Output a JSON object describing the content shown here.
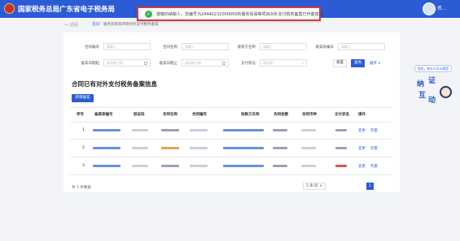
{
  "header": {
    "brand": "国家税务总局广东省电子税务局",
    "user": "郑..."
  },
  "toast": {
    "message": "尊敬的纳税人，您编号为24440232000000的服务贸易等项目对外支付税务备案已作废成功。"
  },
  "breadcrumb": {
    "back": "← 返回",
    "home": "首页",
    "sep": "/",
    "current": "服务贸易等项目对外支付税务备案"
  },
  "filters": {
    "contract_no": {
      "label": "合同编号",
      "placeholder": "请输入"
    },
    "contract_name": {
      "label": "合同名称",
      "placeholder": "请输入"
    },
    "payee_name": {
      "label": "收款方名称",
      "placeholder": "请输入"
    },
    "record_no": {
      "label": "备案表编号",
      "placeholder": "请输入"
    },
    "date_from": {
      "label": "备案日期起",
      "placeholder": "请选择日期"
    },
    "date_to": {
      "label": "备案日期止",
      "placeholder": "请选择日期"
    },
    "pay_status": {
      "label": "支付状态",
      "placeholder": "请选择"
    }
  },
  "buttons": {
    "reset": "重置",
    "query": "查询",
    "expand": "展开 ∨",
    "add": "新增备案"
  },
  "section_title": "合同已有对外支付税务备案信息",
  "table": {
    "columns": [
      "序号",
      "备案表编号",
      "验证码",
      "合同名称",
      "合同编号",
      "收款方名称",
      "合同金额",
      "合同币种",
      "支付状态",
      "操作"
    ],
    "rows": [
      {
        "no": "1",
        "action_edit": "变更",
        "action_void": "作废"
      },
      {
        "no": "2",
        "action_edit": "变更",
        "action_void": "作废"
      },
      {
        "no": "3",
        "action_edit": "变更",
        "action_void": "作废"
      }
    ]
  },
  "pagination": {
    "total": "共 3 条数据",
    "page_size": "5 条/页 ∨",
    "prev": "‹",
    "current_page": "1",
    "next": "›"
  },
  "helper": {
    "bubble": "您好，有什么可以帮您",
    "char1": "纳",
    "char2": "证",
    "char3": "互",
    "char4": "动"
  }
}
